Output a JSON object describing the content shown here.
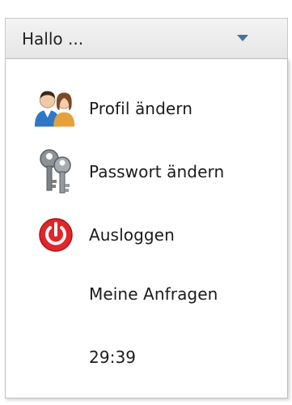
{
  "header": {
    "greeting": "Hallo ...",
    "chevron_icon": "chevron-down-icon"
  },
  "menu": {
    "items": [
      {
        "label": "Profil ändern",
        "icon": "users-icon"
      },
      {
        "label": "Passwort ändern",
        "icon": "keys-icon"
      },
      {
        "label": "Ausloggen",
        "icon": "power-icon"
      },
      {
        "label": "Meine Anfragen"
      }
    ],
    "session_timer": "29:39"
  },
  "colors": {
    "accent": "#4c6e9e",
    "power_red": "#e0262b",
    "border": "#bfbfbf"
  }
}
